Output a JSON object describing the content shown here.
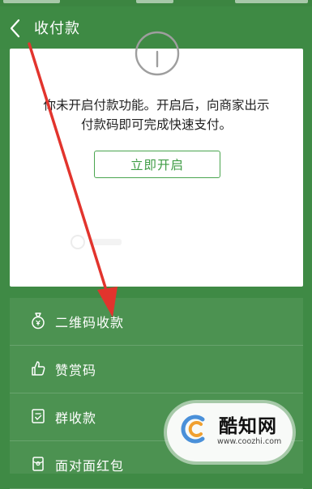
{
  "header": {
    "title": "收付款",
    "back_icon": "chevron-left-icon"
  },
  "card": {
    "notice_line1": "你未开启付款功能。开启后，向商家出示",
    "notice_line2": "付款码即可完成快速支付。",
    "enable_button_label": "立即开启"
  },
  "menu": {
    "items": [
      {
        "label": "二维码收款",
        "icon": "qr-money-bag-icon"
      },
      {
        "label": "赞赏码",
        "icon": "thumbs-up-icon"
      },
      {
        "label": "群收款",
        "icon": "group-bill-icon"
      },
      {
        "label": "面对面红包",
        "icon": "red-packet-icon"
      }
    ]
  },
  "watermark": {
    "name": "酷知网",
    "url": "www.coozhi.com"
  },
  "colors": {
    "background_green": "#3f8a45",
    "menu_green": "#4c9251",
    "accent_green": "#4aa54f",
    "annotation_red": "#e2342d"
  }
}
